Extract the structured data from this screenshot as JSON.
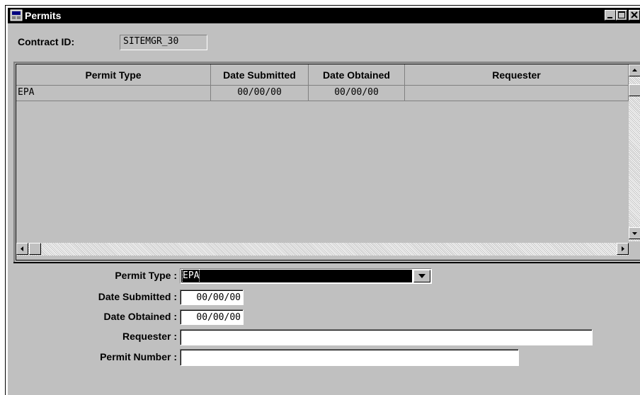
{
  "window": {
    "title": "Permits"
  },
  "contract": {
    "label": "Contract ID:",
    "value": "SITEMGR_30"
  },
  "grid": {
    "columns": [
      "Permit Type",
      "Date Submitted",
      "Date Obtained",
      "Requester"
    ],
    "rows": [
      [
        "EPA",
        "00/00/00",
        "00/00/00",
        ""
      ]
    ]
  },
  "form": {
    "permit_type_label": "Permit Type :",
    "permit_type_value": "EPA",
    "date_submitted_label": "Date Submitted :",
    "date_submitted_value": "00/00/00",
    "date_obtained_label": "Date Obtained :",
    "date_obtained_value": "00/00/00",
    "requester_label": "Requester :",
    "requester_value": "",
    "permit_number_label": "Permit Number :",
    "permit_number_value": ""
  },
  "icons": {
    "app": "permits-app-icon",
    "minimize": "minimize-icon",
    "maximize": "maximize-icon",
    "close": "close-icon",
    "dropdown": "chevron-down-icon"
  }
}
